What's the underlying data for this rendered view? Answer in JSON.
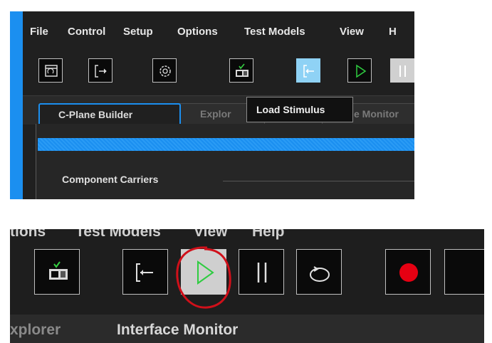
{
  "menu": {
    "file": "File",
    "control": "Control",
    "setup": "Setup",
    "options": "Options",
    "test_models": "Test Models",
    "view": "View",
    "help_partial": "H"
  },
  "tooltip": "Load Stimulus",
  "tabs": {
    "cplane": "C-Plane Builder",
    "explorer_partial": "Explor",
    "monitor_partial": "e Monitor"
  },
  "content": {
    "component_carriers": "Component Carriers"
  },
  "zoom_menu": {
    "options_partial": "tions",
    "test_models": "Test Models",
    "view": "View",
    "help": "Help"
  },
  "zoom_tabs": {
    "explorer_partial": "xplorer",
    "interface_monitor": "Interface Monitor"
  },
  "colors": {
    "accent_blue": "#1b8ff0",
    "play_green": "#2ecc40",
    "record_red": "#e60012",
    "annotation_red": "#d0101a"
  },
  "icons": [
    "open-folder-icon",
    "exit-icon",
    "gear-icon",
    "instrument-check-icon",
    "load-stimulus-icon",
    "play-icon",
    "pause-icon",
    "loop-icon",
    "record-icon"
  ]
}
